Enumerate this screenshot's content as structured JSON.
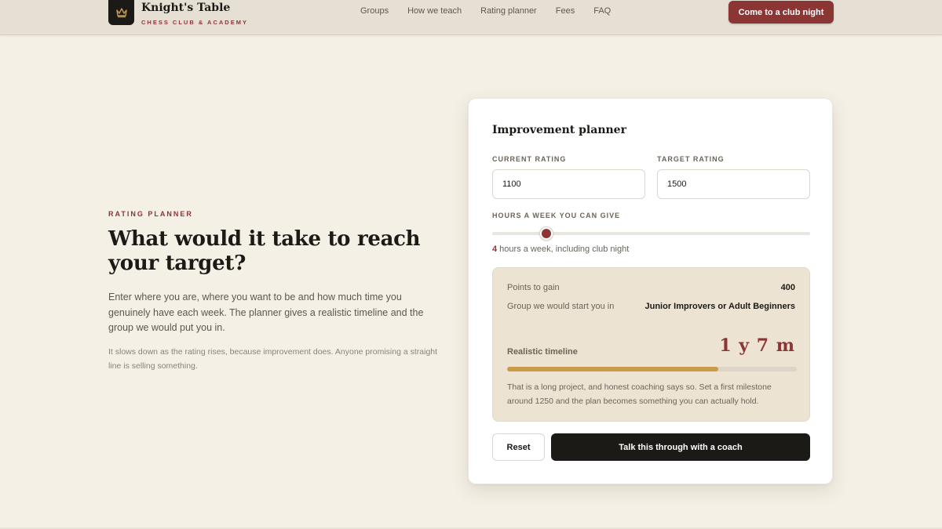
{
  "brand": {
    "name": "Knight's Table",
    "subtitle": "CHESS CLUB & ACADEMY",
    "logo_icon": "crown-icon",
    "logo_color": "#c99a47"
  },
  "nav": {
    "items": [
      {
        "label": "Groups"
      },
      {
        "label": "How we teach"
      },
      {
        "label": "Rating planner"
      },
      {
        "label": "Fees"
      },
      {
        "label": "FAQ"
      }
    ],
    "cta_label": "Come to a club night"
  },
  "hero": {
    "eyebrow": "RATING PLANNER",
    "title": "What would it take to reach your target?",
    "body": "Enter where you are, where you want to be and how much time you genuinely have each week. The planner gives a realistic timeline and the group we would put you in.",
    "note": "It slows down as the rating rises, because improvement does. Anyone promising a straight line is selling something."
  },
  "planner": {
    "title": "Improvement planner",
    "current_rating_label": "CURRENT RATING",
    "current_rating_value": "1100",
    "target_rating_label": "TARGET RATING",
    "target_rating_value": "1500",
    "hours_label": "HOURS A WEEK YOU CAN GIVE",
    "hours_value": "4",
    "hours_fraction": 0.17,
    "hours_caption": " hours a week, including club night",
    "results": {
      "points_label": "Points to gain",
      "points_value": "400",
      "group_label": "Group we would start you in",
      "group_value": "Junior Improvers or Adult Beginners",
      "timeline_label": "Realistic timeline",
      "timeline_value": "1 y 7 m",
      "timeline_progress": 0.73,
      "note": "That is a long project, and honest coaching says so. Set a first milestone around 1250 and the plan becomes something you can actually hold."
    },
    "reset_label": "Reset",
    "coach_label": "Talk this through with a coach"
  },
  "colors": {
    "accent": "#8c3535",
    "gold": "#c99a47",
    "dark": "#1c1a17",
    "background": "#f5f0e6"
  }
}
